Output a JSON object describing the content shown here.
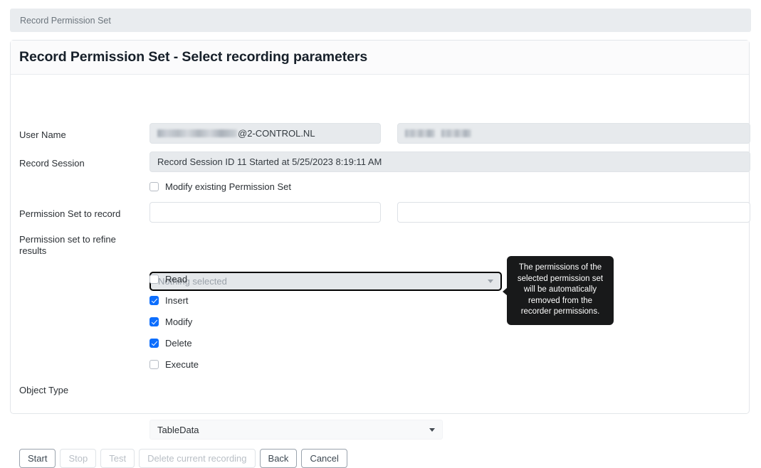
{
  "breadcrumb": {
    "text": "Record Permission Set"
  },
  "header": {
    "title": "Record Permission Set - Select recording parameters"
  },
  "form": {
    "user_name": {
      "label": "User Name",
      "value_suffix": "@2-CONTROL.NL",
      "secondary_value": ""
    },
    "record_session": {
      "label": "Record Session",
      "value": "Record Session ID 11 Started at 5/25/2023 8:19:11 AM"
    },
    "modify_existing": {
      "label": "Modify existing Permission Set",
      "checked": false
    },
    "permission_set_to_record": {
      "label": "Permission Set to record",
      "value_left": "",
      "value_right": ""
    },
    "permission_set_to_refine": {
      "label_line1": "Permission set to refine",
      "label_line2": "results",
      "placeholder": "Nothing selected"
    },
    "object_type": {
      "label": "Object Type",
      "value": "TableData"
    }
  },
  "permissions": [
    {
      "label": "Read",
      "checked": false
    },
    {
      "label": "Insert",
      "checked": true
    },
    {
      "label": "Modify",
      "checked": true
    },
    {
      "label": "Delete",
      "checked": true
    },
    {
      "label": "Execute",
      "checked": false
    }
  ],
  "tooltip": {
    "text": "The permissions of the selected permission set will be automatically removed from the recorder permissions."
  },
  "buttons": [
    {
      "label": "Start",
      "enabled": true
    },
    {
      "label": "Stop",
      "enabled": false
    },
    {
      "label": "Test",
      "enabled": false
    },
    {
      "label": "Delete current recording",
      "enabled": false
    },
    {
      "label": "Back",
      "enabled": true
    },
    {
      "label": "Cancel",
      "enabled": true
    }
  ],
  "colors": {
    "accent": "#0d6efd",
    "breadcrumb_bg": "#e9ecef",
    "readonly_bg": "#e7eaed",
    "tooltip_bg": "#18191a"
  }
}
